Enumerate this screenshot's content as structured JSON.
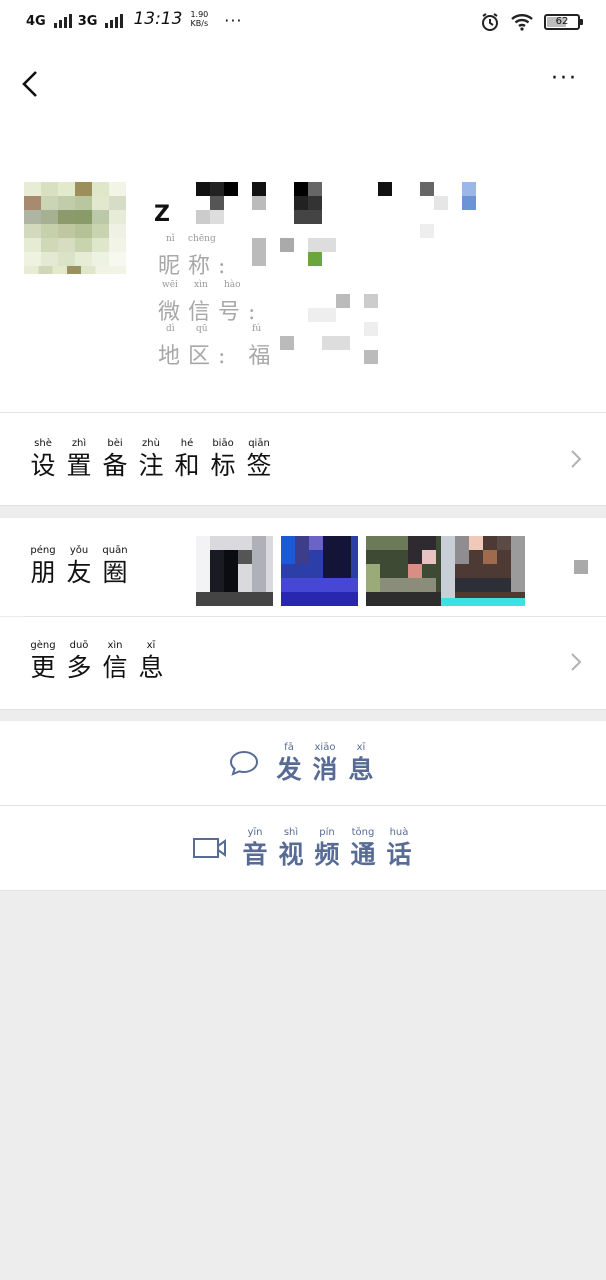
{
  "status_bar": {
    "network1": "4G",
    "network2": "3G",
    "time": "13:13",
    "speed_value": "1.90",
    "speed_unit": "KB/s",
    "more": "···",
    "battery": "62",
    "icons": [
      "signal-icon",
      "alarm-icon",
      "wifi-icon",
      "battery-icon"
    ]
  },
  "nav": {
    "back_icon": "chevron-left-icon",
    "more": "···"
  },
  "profile": {
    "name_initial": "Z",
    "nickname": {
      "pinyin": [
        "nǐ",
        "chēng"
      ],
      "hanzi": "昵称:"
    },
    "wechat_id": {
      "pinyin": [
        "wēi",
        "xìn",
        "hào"
      ],
      "hanzi": "微信号:"
    },
    "region": {
      "pinyin": [
        "dì",
        "qū",
        "fú"
      ],
      "hanzi": "地区: 福"
    }
  },
  "set_remark": {
    "chars": [
      {
        "p": "shè",
        "h": "设"
      },
      {
        "p": "zhì",
        "h": "置"
      },
      {
        "p": "bèi",
        "h": "备"
      },
      {
        "p": "zhù",
        "h": "注"
      },
      {
        "p": "hé",
        "h": "和"
      },
      {
        "p": "biāo",
        "h": "标"
      },
      {
        "p": "qiān",
        "h": "签"
      }
    ]
  },
  "moments": {
    "chars": [
      {
        "p": "péng",
        "h": "朋"
      },
      {
        "p": "yǒu",
        "h": "友"
      },
      {
        "p": "quān",
        "h": "圈"
      }
    ]
  },
  "more_info": {
    "chars": [
      {
        "p": "gèng",
        "h": "更"
      },
      {
        "p": "duō",
        "h": "多"
      },
      {
        "p": "xìn",
        "h": "信"
      },
      {
        "p": "xī",
        "h": "息"
      }
    ]
  },
  "send_message": {
    "icon": "chat-bubble-icon",
    "chars": [
      {
        "p": "fā",
        "h": "发"
      },
      {
        "p": "xiāo",
        "h": "消"
      },
      {
        "p": "xī",
        "h": "息"
      }
    ]
  },
  "video_call": {
    "icon": "video-camera-icon",
    "chars": [
      {
        "p": "yīn",
        "h": "音"
      },
      {
        "p": "shì",
        "h": "视"
      },
      {
        "p": "pín",
        "h": "频"
      },
      {
        "p": "tōng",
        "h": "通"
      },
      {
        "p": "huà",
        "h": "话"
      }
    ]
  },
  "colors": {
    "link": "#576b95",
    "background": "#ededed"
  }
}
